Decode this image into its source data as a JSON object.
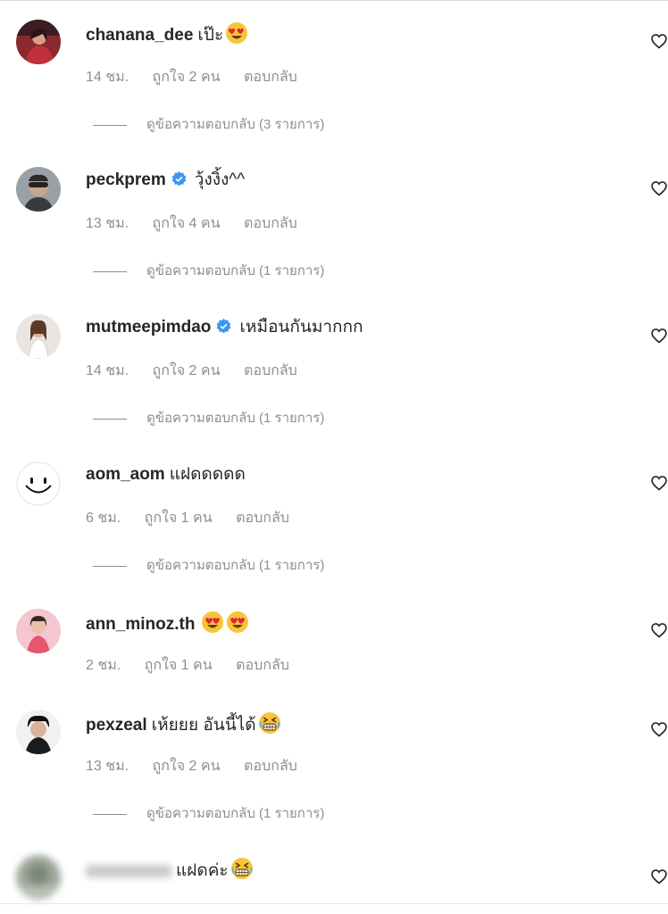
{
  "comments": [
    {
      "username": "chanana_dee",
      "verified": false,
      "text": "เป๊ะ",
      "emojis": [
        "heart-eyes"
      ],
      "time": "14 ชม.",
      "likes": "ถูกใจ 2 คน",
      "reply_label": "ตอบกลับ",
      "view_replies": "ดูข้อความตอบกลับ (3 รายการ)",
      "avatar_icon": "profile-photo"
    },
    {
      "username": "peckprem",
      "verified": true,
      "text": "วุ้งงิ้ง^^",
      "emojis": [],
      "time": "13 ชม.",
      "likes": "ถูกใจ 4 คน",
      "reply_label": "ตอบกลับ",
      "view_replies": "ดูข้อความตอบกลับ (1 รายการ)",
      "avatar_icon": "profile-photo"
    },
    {
      "username": "mutmeepimdao",
      "verified": true,
      "text": "เหมือนกันมากกก",
      "emojis": [],
      "time": "14 ชม.",
      "likes": "ถูกใจ 2 คน",
      "reply_label": "ตอบกลับ",
      "view_replies": "ดูข้อความตอบกลับ (1 รายการ)",
      "avatar_icon": "profile-photo"
    },
    {
      "username": "aom_aom",
      "verified": false,
      "text": "แฝดดดดด",
      "emojis": [],
      "time": "6 ชม.",
      "likes": "ถูกใจ 1 คน",
      "reply_label": "ตอบกลับ",
      "view_replies": "ดูข้อความตอบกลับ (1 รายการ)",
      "avatar_icon": "smiley-face"
    },
    {
      "username": "ann_minoz.th",
      "verified": false,
      "text": "",
      "emojis": [
        "heart-eyes",
        "heart-eyes"
      ],
      "time": "2 ชม.",
      "likes": "ถูกใจ 1 คน",
      "reply_label": "ตอบกลับ",
      "view_replies": "",
      "avatar_icon": "profile-photo"
    },
    {
      "username": "pexzeal",
      "verified": false,
      "text": "เห้ยยย อันนี้ได้",
      "emojis": [
        "grinning-squinting"
      ],
      "time": "13 ชม.",
      "likes": "ถูกใจ 2 คน",
      "reply_label": "ตอบกลับ",
      "view_replies": "ดูข้อความตอบกลับ (1 รายการ)",
      "avatar_icon": "profile-photo"
    },
    {
      "username": "",
      "verified": false,
      "text": "แฝดค่ะ",
      "emojis": [
        "grinning-squinting"
      ],
      "time": "",
      "likes": "",
      "reply_label": "",
      "view_replies": "",
      "avatar_icon": "blurred-profile-photo"
    }
  ],
  "colors": {
    "text": "#262626",
    "secondary": "#8e8e8e",
    "verified": "#3897f0",
    "divider": "#dbdbdb"
  }
}
